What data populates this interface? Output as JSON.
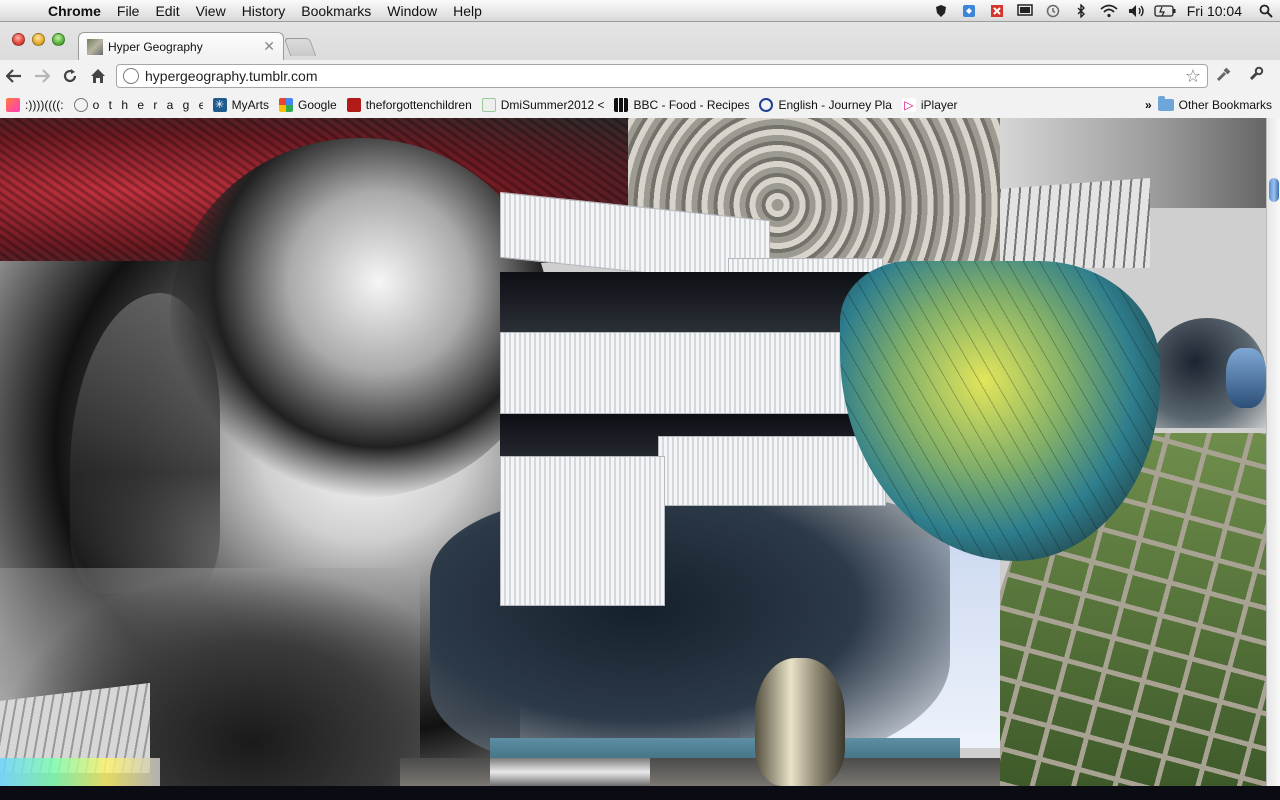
{
  "menubar": {
    "app_name": "Chrome",
    "menus": [
      "File",
      "Edit",
      "View",
      "History",
      "Bookmarks",
      "Window",
      "Help"
    ],
    "status_icons": [
      "shield-icon",
      "dropbox-icon",
      "app-icon",
      "display-icon",
      "time-machine-icon",
      "bluetooth-icon",
      "wifi-icon",
      "volume-icon",
      "battery-icon"
    ],
    "clock": "Fri 10:04",
    "search_icon": "spotlight-icon"
  },
  "browser": {
    "tab": {
      "title": "Hyper Geography"
    },
    "address": {
      "url": "hypergeography.tumblr.com"
    },
    "bookmarks": [
      {
        "label": ":))))((((:",
        "icon": "square-orange"
      },
      {
        "label": "o t h e r a g e n t s .",
        "icon": "globe"
      },
      {
        "label": "MyArts",
        "icon": "snowflake"
      },
      {
        "label": "Google",
        "icon": "google"
      },
      {
        "label": "theforgottenchildren",
        "icon": "image"
      },
      {
        "label": "DmiSummer2012 <",
        "icon": "page"
      },
      {
        "label": "BBC - Food - Recipes",
        "icon": "bbc"
      },
      {
        "label": "English - Journey Pla",
        "icon": "tfl"
      },
      {
        "label": "iPlayer",
        "icon": "iplayer"
      }
    ],
    "other_bookmarks": "Other Bookmarks"
  },
  "colors": {
    "accent_blue": "#5a8fd2",
    "red_rock": "#c2323e",
    "labradorite": "#e2e65a"
  }
}
